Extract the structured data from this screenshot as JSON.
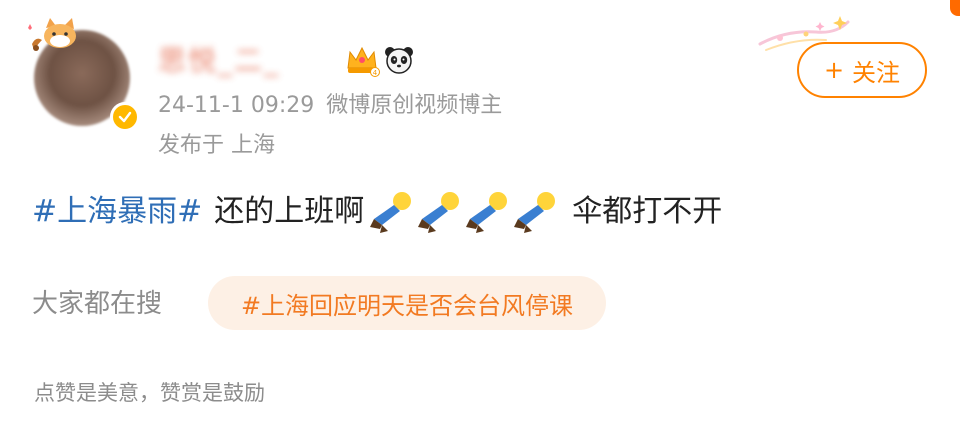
{
  "user": {
    "name": "思悦_二_",
    "verified": true,
    "badges": [
      "crown-icon",
      "panda-icon"
    ]
  },
  "post": {
    "timestamp": "24-11-1 09:29",
    "author_title": "微博原创视频博主",
    "location": "发布于 上海",
    "hashtag": "#上海暴雨#",
    "text_before": "还的上班啊",
    "emoji": [
      "person-flat-emoji",
      "person-flat-emoji",
      "person-flat-emoji",
      "person-flat-emoji"
    ],
    "text_after": "伞都打不开"
  },
  "follow": {
    "plus": "+",
    "label": "关注"
  },
  "search": {
    "label": "大家都在搜",
    "topic": "#上海回应明天是否会台风停课"
  },
  "like_hint": "点赞是美意，赞赏是鼓励",
  "colors": {
    "accent": "#ff8200",
    "hashtag": "#2f6eb6",
    "search_pill_bg": "#fdf0e5",
    "search_pill_text": "#f27a22",
    "meta": "#9a9a9a"
  }
}
